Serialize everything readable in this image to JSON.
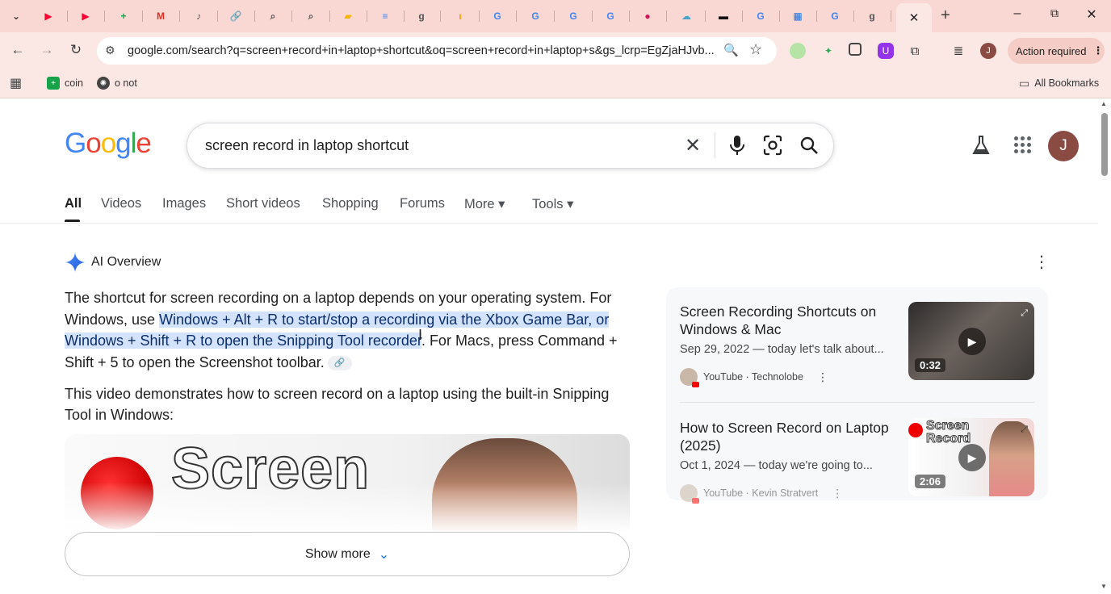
{
  "browser": {
    "tabs": [
      {
        "icon": "tab-search-icon",
        "label": "⌄"
      },
      {
        "icon": "youtube-icon",
        "label": "▶",
        "color": "#ff0033"
      },
      {
        "icon": "youtube-icon",
        "label": "▶",
        "color": "#ff0033"
      },
      {
        "icon": "sheets-icon",
        "label": "+",
        "color": "#16a34a"
      },
      {
        "icon": "gmail-icon",
        "label": "M",
        "color": "#d93025"
      },
      {
        "icon": "music-icon",
        "label": "♪",
        "color": "#555555"
      },
      {
        "icon": "link-icon",
        "label": "🔗",
        "color": "#1a73e8"
      },
      {
        "icon": "search-icon",
        "label": "⌕",
        "color": "#555555"
      },
      {
        "icon": "search-icon",
        "label": "⌕",
        "color": "#555555"
      },
      {
        "icon": "folder-icon",
        "label": "▰",
        "color": "#f4b400"
      },
      {
        "icon": "docs-icon",
        "label": "≡",
        "color": "#4285f4"
      },
      {
        "icon": "google-icon",
        "label": "g",
        "color": "#555555"
      },
      {
        "icon": "tab-orange-icon",
        "label": "ı",
        "color": "#f59e0b"
      },
      {
        "icon": "google-icon",
        "label": "G",
        "color": "#4285f4"
      },
      {
        "icon": "google-icon",
        "label": "G",
        "color": "#4285f4"
      },
      {
        "icon": "google-icon",
        "label": "G",
        "color": "#4285f4"
      },
      {
        "icon": "google-icon",
        "label": "G",
        "color": "#4285f4"
      },
      {
        "icon": "fire-icon",
        "label": "●",
        "color": "#d4145a"
      },
      {
        "icon": "cloud-icon",
        "label": "☁",
        "color": "#4aa3c7"
      },
      {
        "icon": "imdb-icon",
        "label": "▬",
        "color": "#111111"
      },
      {
        "icon": "google-icon",
        "label": "G",
        "color": "#4285f4"
      },
      {
        "icon": "grid-icon",
        "label": "▦",
        "color": "#1a73e8"
      },
      {
        "icon": "google-icon",
        "label": "G",
        "color": "#4285f4"
      },
      {
        "icon": "google-icon",
        "label": "g",
        "color": "#555555"
      }
    ],
    "active_tab_close": "✕",
    "new_tab": "+",
    "window": {
      "minimize": "–",
      "maximize": "⧉",
      "close": "✕"
    },
    "url": "google.com/search?q=screen+record+in+laptop+shortcut&oq=screen+record+in+laptop+s&gs_lcrp=EgZjaHJvb...",
    "action_required": "Action required",
    "profile_initial": "J",
    "bookmarks": [
      {
        "label": "coin",
        "icon": "sheets-icon",
        "color": "#16a34a"
      },
      {
        "label": "o not",
        "icon": "openai-icon",
        "color": "#444444"
      }
    ],
    "all_bookmarks": "All Bookmarks"
  },
  "google": {
    "logo": [
      "G",
      "o",
      "o",
      "g",
      "l",
      "e"
    ],
    "logo_colors": [
      "#4285f4",
      "#ea4335",
      "#fbbc05",
      "#4285f4",
      "#34a853",
      "#ea4335"
    ],
    "query": "screen record in laptop shortcut",
    "avatar_initial": "J",
    "filters": [
      "All",
      "Videos",
      "Images",
      "Short videos",
      "Shopping",
      "Forums",
      "More ▾",
      "Tools ▾"
    ]
  },
  "ai_overview": {
    "title": "AI Overview",
    "p1_before": "The shortcut for screen recording on a laptop depends on your operating system. For Windows, use ",
    "p1_highlight": "Windows + Alt + R to start/stop a recording via the Xbox Game Bar, or Windows + Shift + R to open the Snipping Tool recorder",
    "p1_after": ". For Macs, press Command + Shift + 5 to open the Screenshot toolbar.",
    "link_chip": "🔗",
    "p2": "This video demonstrates how to screen record on a laptop using the built-in Snipping Tool in Windows:",
    "video_text": "Screen",
    "show_more": "Show more",
    "show_more_chevron": "⌄"
  },
  "videos": [
    {
      "title": "Screen Recording Shortcuts on Windows & Mac",
      "snippet": "Sep 29, 2022 — today let's talk about...",
      "source": "YouTube · Technolobe",
      "duration": "0:32"
    },
    {
      "title": "How to Screen Record on Laptop (2025)",
      "snippet": "Oct 1, 2024 — today we're going to...",
      "source": "YouTube · Kevin Stratvert",
      "duration": "2:06",
      "thumb_text": "Screen Record"
    }
  ]
}
